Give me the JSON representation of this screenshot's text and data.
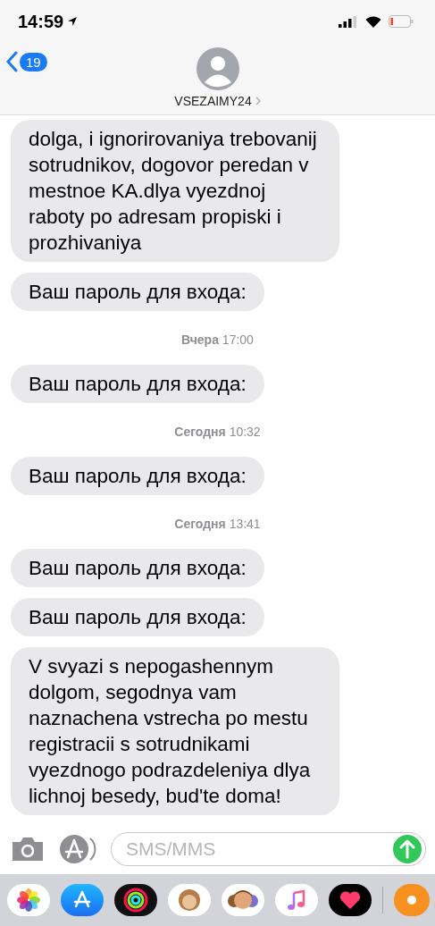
{
  "status_bar": {
    "time": "14:59"
  },
  "header": {
    "back_count": "19",
    "contact": "VSEZAIMY24"
  },
  "messages": [
    {
      "kind": "message",
      "text": "dolga, i ignorirovaniya trebovanij sotrudnikov, dogovor peredan v mestnoe KA.dlya vyezdnoj raboty po adresam propiski i prozhivaniya"
    },
    {
      "kind": "message",
      "text": "Ваш пароль для входа:"
    },
    {
      "kind": "timestamp",
      "day": "Вчера",
      "time": "17:00"
    },
    {
      "kind": "message",
      "text": "Ваш пароль для входа:"
    },
    {
      "kind": "timestamp",
      "day": "Сегодня",
      "time": "10:32"
    },
    {
      "kind": "message",
      "text": "Ваш пароль для входа:"
    },
    {
      "kind": "timestamp",
      "day": "Сегодня",
      "time": "13:41"
    },
    {
      "kind": "message",
      "text": "Ваш пароль для входа:"
    },
    {
      "kind": "message",
      "text": "Ваш пароль для входа:"
    },
    {
      "kind": "message",
      "text": "V svyazi s nepogashennym dolgom, segodnya vam naznachena vstrecha po mestu registracii s sotrudnikami vyezdnogo podrazdeleniya dlya lichnoj besedy, bud'te doma!"
    }
  ],
  "composer": {
    "placeholder": "SMS/MMS"
  },
  "app_drawer": [
    {
      "kind": "photos"
    },
    {
      "kind": "appstore"
    },
    {
      "kind": "activity"
    },
    {
      "kind": "animoji"
    },
    {
      "kind": "memoji"
    },
    {
      "kind": "music"
    },
    {
      "kind": "heart"
    },
    {
      "kind": "orange"
    }
  ]
}
